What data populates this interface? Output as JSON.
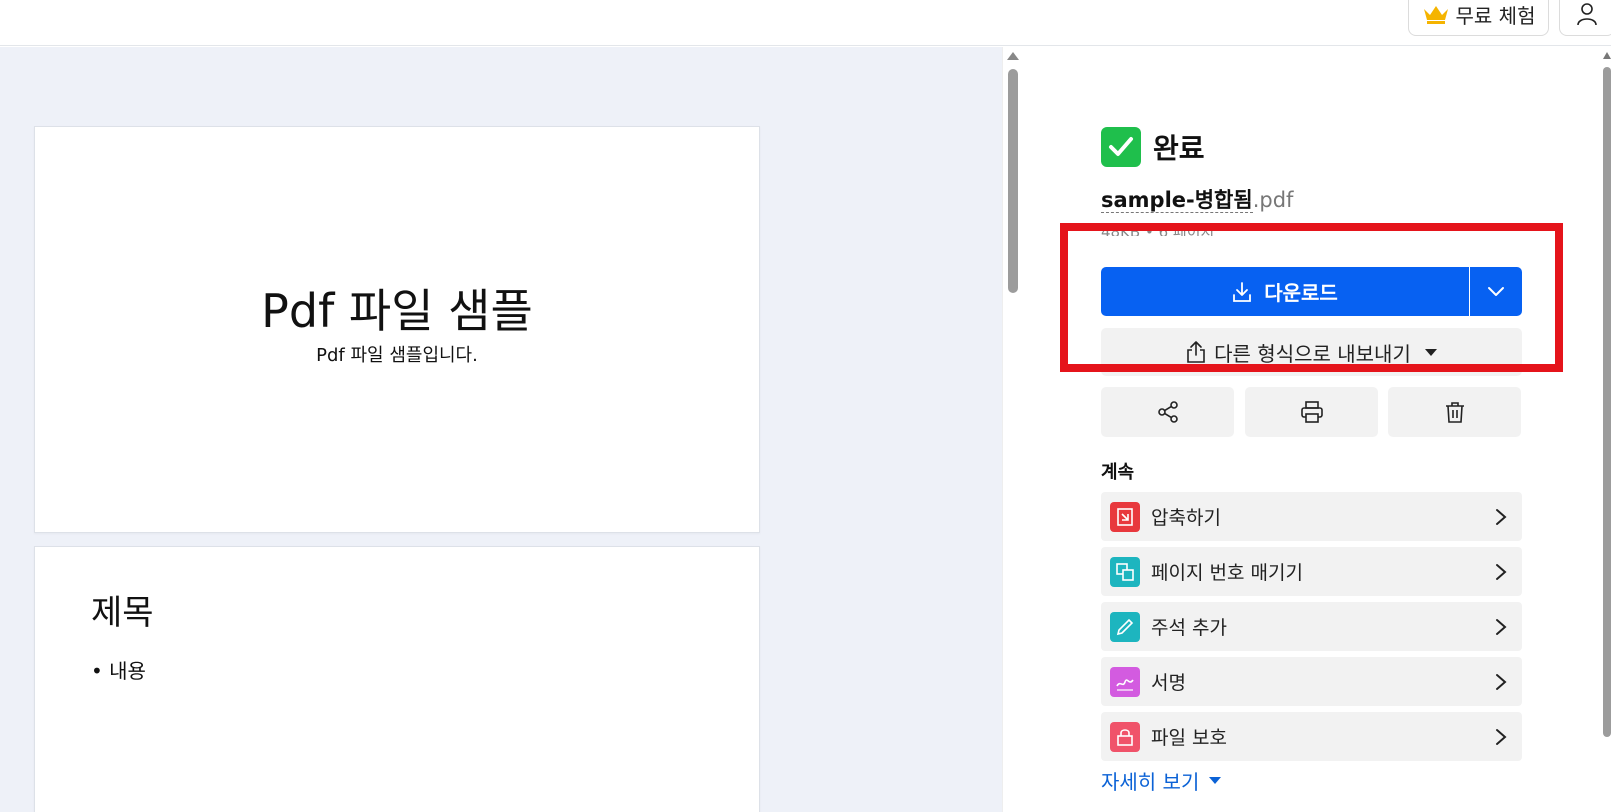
{
  "topbar": {
    "trial_label": "무료 체험",
    "trial_icon": "crown-icon",
    "user_icon": "user-icon"
  },
  "preview": {
    "page1": {
      "title": "Pdf 파일 샘플",
      "subtitle": "Pdf 파일 샘플입니다."
    },
    "page2": {
      "title": "제목",
      "bullet": "• 내용"
    }
  },
  "result": {
    "status": "완료",
    "file_base": "sample-병합됨",
    "file_ext": ".pdf",
    "meta": "48KB • 6 페이지",
    "download_label": "다운로드",
    "export_label": "다른 형식으로 내보내기"
  },
  "actions": [
    {
      "name": "share",
      "icon": "share-icon"
    },
    {
      "name": "print",
      "icon": "printer-icon"
    },
    {
      "name": "delete",
      "icon": "trash-icon"
    }
  ],
  "continue": {
    "label": "계속",
    "tools": [
      {
        "label": "압축하기",
        "icon": "compress-icon",
        "color": "#e8383d"
      },
      {
        "label": "페이지 번호 매기기",
        "icon": "page-number-icon",
        "color": "#1db5bf"
      },
      {
        "label": "주석 추가",
        "icon": "annotate-icon",
        "color": "#1db5bf"
      },
      {
        "label": "서명",
        "icon": "signature-icon",
        "color": "#d35be0"
      },
      {
        "label": "파일 보호",
        "icon": "lock-icon",
        "color": "#f0536a"
      }
    ],
    "more_label": "자세히 보기"
  },
  "colors": {
    "accent": "#0761f2",
    "success": "#1fbf4c",
    "highlight": "#e5141b",
    "link": "#0b62d6"
  }
}
